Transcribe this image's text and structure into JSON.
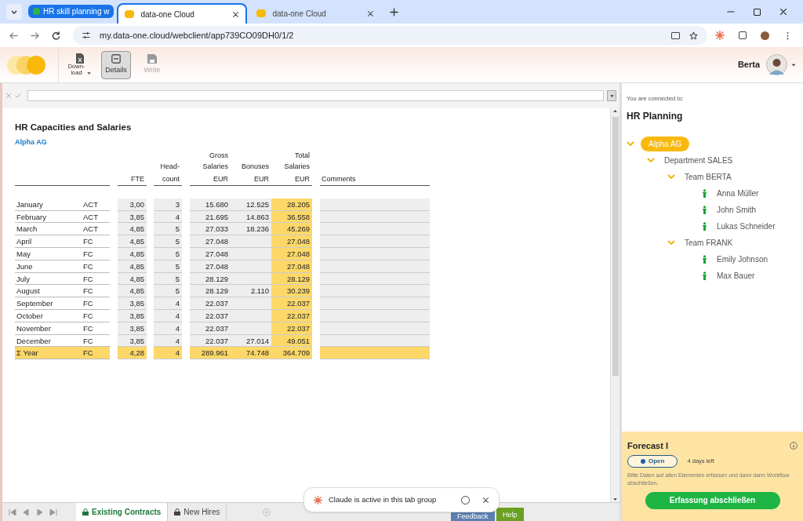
{
  "browser": {
    "tabs": [
      {
        "label": "HR skill planning w",
        "kind": "group",
        "selected": false
      },
      {
        "label": "data-one Cloud",
        "kind": "page",
        "selected": true
      },
      {
        "label": "data-one Cloud",
        "kind": "page",
        "selected": false
      }
    ],
    "url": "my.data-one.cloud/webclient/app739CO09DH0/1/2"
  },
  "toolbar": {
    "buttons": [
      {
        "lines": [
          "Down-",
          "load"
        ],
        "kind": "download",
        "selected": false,
        "disabled": false
      },
      {
        "lines": [
          "Details"
        ],
        "kind": "details",
        "selected": true,
        "disabled": false
      },
      {
        "lines": [
          "Write"
        ],
        "kind": "write",
        "selected": false,
        "disabled": true
      }
    ],
    "user": "Berta"
  },
  "sheet": {
    "title": "HR Capacities and Salaries",
    "subtitle": "Alpha AG",
    "columns": [
      [
        "FTE"
      ],
      [
        "Head-",
        "count"
      ],
      [
        "Gross",
        "Salaries",
        "EUR"
      ],
      [
        "Bonuses",
        "EUR"
      ],
      [
        "Total",
        "Salaries",
        "EUR"
      ],
      [
        "Comments"
      ]
    ],
    "rows": [
      {
        "month": "January",
        "type": "ACT",
        "fte": "3,00",
        "headcount": "3",
        "gross": "15.680",
        "bonuses": "12.525",
        "total": "28.205"
      },
      {
        "month": "February",
        "type": "ACT",
        "fte": "3,85",
        "headcount": "4",
        "gross": "21.695",
        "bonuses": "14.863",
        "total": "36.558"
      },
      {
        "month": "March",
        "type": "ACT",
        "fte": "4,85",
        "headcount": "5",
        "gross": "27.033",
        "bonuses": "18.236",
        "total": "45.269"
      },
      {
        "month": "April",
        "type": "FC",
        "fte": "4,85",
        "headcount": "5",
        "gross": "27.048",
        "total": "27.048"
      },
      {
        "month": "May",
        "type": "FC",
        "fte": "4,85",
        "headcount": "5",
        "gross": "27.048",
        "total": "27.048"
      },
      {
        "month": "June",
        "type": "FC",
        "fte": "4,85",
        "headcount": "5",
        "gross": "27.048",
        "total": "27.048"
      },
      {
        "month": "July",
        "type": "FC",
        "fte": "4,85",
        "headcount": "5",
        "gross": "28.129",
        "total": "28.129"
      },
      {
        "month": "August",
        "type": "FC",
        "fte": "4,85",
        "headcount": "5",
        "gross": "28.129",
        "bonuses": "2.110",
        "total": "30.239"
      },
      {
        "month": "September",
        "type": "FC",
        "fte": "3,85",
        "headcount": "4",
        "gross": "22.037",
        "total": "22.037"
      },
      {
        "month": "October",
        "type": "FC",
        "fte": "3,85",
        "headcount": "4",
        "gross": "22.037",
        "total": "22.037"
      },
      {
        "month": "November",
        "type": "FC",
        "fte": "3,85",
        "headcount": "4",
        "gross": "22.037",
        "total": "22.037"
      },
      {
        "month": "December",
        "type": "FC",
        "fte": "3,85",
        "headcount": "4",
        "gross": "22.037",
        "bonuses": "27.014",
        "total": "49.051"
      }
    ],
    "total": {
      "month": "Σ Year",
      "type": "FC",
      "fte": "4,28",
      "headcount": "4",
      "gross": "289.961",
      "bonuses": "74.748",
      "total": "364.709"
    },
    "tabs": [
      {
        "label": "Existing Contracts",
        "selected": true
      },
      {
        "label": "New Hires",
        "selected": false
      }
    ]
  },
  "panel": {
    "connected": "You are connected to:",
    "title": "HR Planning",
    "tree": [
      {
        "label": "Alpha AG",
        "kind": "org",
        "selected": true,
        "expanded": true,
        "children": [
          {
            "label": "Department SALES",
            "kind": "org",
            "selected": false,
            "expanded": true,
            "children": [
              {
                "label": "Team BERTA",
                "kind": "org",
                "selected": false,
                "expanded": true,
                "children": [
                  {
                    "label": "Anna Müller",
                    "kind": "person",
                    "selected": false
                  },
                  {
                    "label": "John Smith",
                    "kind": "person",
                    "selected": false
                  },
                  {
                    "label": "Lukas Schneider",
                    "kind": "person",
                    "selected": false
                  }
                ]
              },
              {
                "label": "Team FRANK",
                "kind": "org",
                "selected": false,
                "expanded": true,
                "children": [
                  {
                    "label": "Emily Johnson",
                    "kind": "person",
                    "selected": false
                  },
                  {
                    "label": "Max Bauer",
                    "kind": "person",
                    "selected": false
                  }
                ]
              }
            ]
          }
        ]
      }
    ],
    "workflow": {
      "title": "Forecast I",
      "status": "Open",
      "remaining": "4 days left",
      "note": "Bitte Daten auf allen Elementen erfassen und dann dann Workflow abschließen.",
      "button": "Erfassung abschließen"
    }
  },
  "footer": {
    "feedback": "Feedback",
    "help": "Help"
  },
  "popup": {
    "text": "Claude is active in this tab group"
  }
}
